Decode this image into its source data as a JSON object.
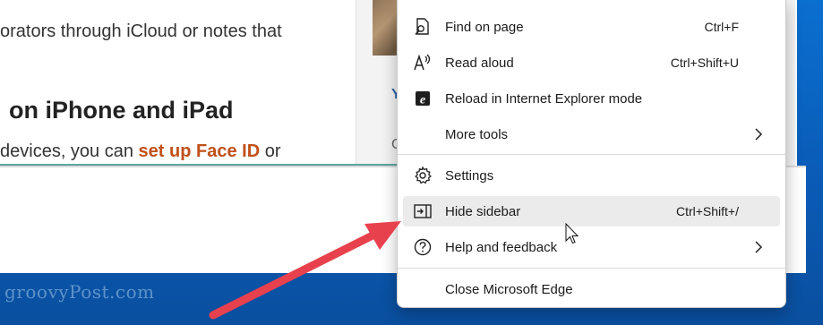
{
  "watermark": "groovyPost.com",
  "article": {
    "line1": "orators through iCloud or notes that",
    "heading": "on iPhone and iPad",
    "line3_prefix": "devices, you can",
    "line3_link": "set up Face ID",
    "line3_suffix": "or"
  },
  "card": {
    "glyph_a": "Y",
    "glyph_b": "C"
  },
  "menu": {
    "items": [
      {
        "label": "Find on page",
        "shortcut": "Ctrl+F",
        "icon": "find-on-page-icon"
      },
      {
        "label": "Read aloud",
        "shortcut": "Ctrl+Shift+U",
        "icon": "read-aloud-icon"
      },
      {
        "label": "Reload in Internet Explorer mode",
        "shortcut": "",
        "icon": "internet-explorer-icon"
      },
      {
        "label": "More tools",
        "shortcut": "",
        "icon": "chevron-right-icon"
      },
      {
        "label": "Settings",
        "shortcut": "",
        "icon": "gear-icon"
      },
      {
        "label": "Hide sidebar",
        "shortcut": "Ctrl+Shift+/",
        "icon": "sidebar-icon"
      },
      {
        "label": "Help and feedback",
        "shortcut": "",
        "icon": "help-icon"
      },
      {
        "label": "Close Microsoft Edge",
        "shortcut": "",
        "icon": ""
      }
    ],
    "highlighted": "Hide sidebar"
  },
  "annotation": {
    "arrow_color": "#e8414e"
  },
  "colors": {
    "link": "#c0501a",
    "desktop": "#0a5bb6",
    "highlight": "#ebebeb"
  }
}
